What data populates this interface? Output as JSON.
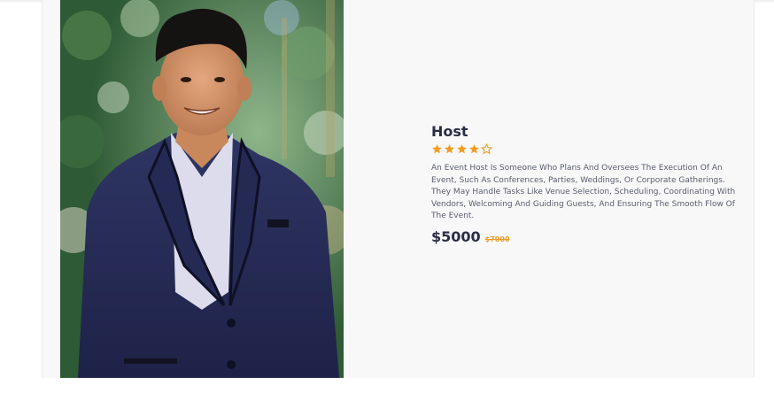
{
  "product": {
    "image_alt": "Host photo",
    "title": "Host",
    "rating": 4,
    "rating_max": 5,
    "description": "An Event Host Is Someone Who Plans And Oversees The Execution Of An Event, Such As Conferences, Parties, Weddings, Or Corporate Gatherings. They May Handle Tasks Like Venue Selection, Scheduling, Coordinating With Vendors, Welcoming And Guiding Guests, And Ensuring The Smooth Flow Of The Event.",
    "price": "$5000",
    "old_price": "$7000"
  },
  "colors": {
    "accent": "#f39c22",
    "title": "#2a2e45",
    "text": "#5a5d6b",
    "card_bg": "#f8f8f9"
  },
  "icons": {
    "star_filled": "star-filled-icon",
    "star_empty": "star-empty-icon"
  }
}
